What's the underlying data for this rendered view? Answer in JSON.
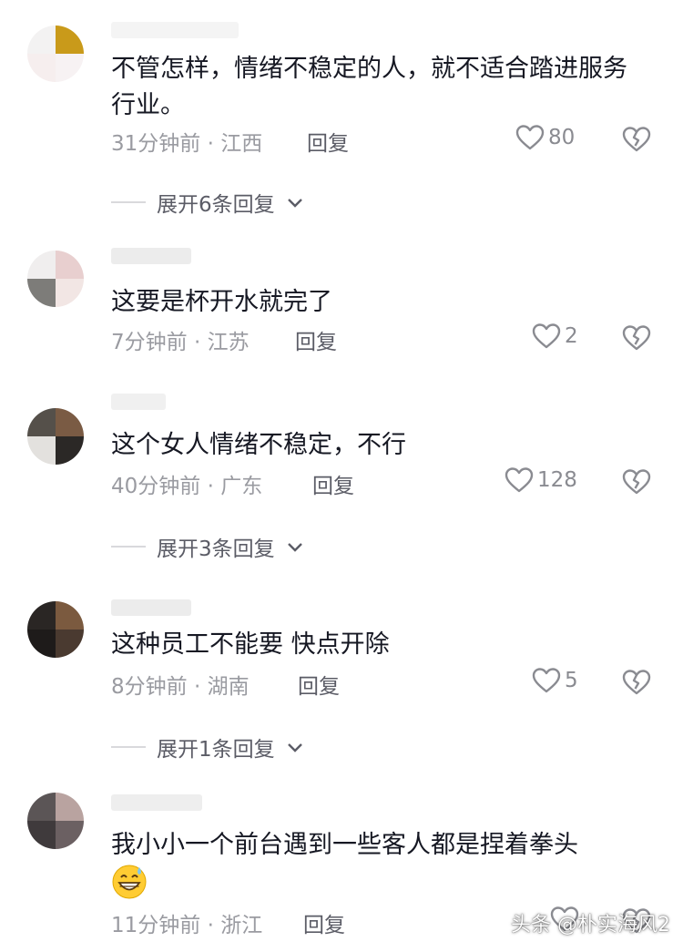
{
  "comments": [
    {
      "text": "不管怎样，情绪不稳定的人，就不适合踏进服务行业。",
      "time": "31分钟前",
      "location": "江西",
      "reply_label": "回复",
      "likes": "80",
      "expand_label": "展开6条回复"
    },
    {
      "text": "这要是杯开水就完了",
      "time": "7分钟前",
      "location": "江苏",
      "reply_label": "回复",
      "likes": "2"
    },
    {
      "text": "这个女人情绪不稳定，不行",
      "time": "40分钟前",
      "location": "广东",
      "reply_label": "回复",
      "likes": "128",
      "expand_label": "展开3条回复"
    },
    {
      "text": "这种员工不能要  快点开除",
      "time": "8分钟前",
      "location": "湖南",
      "reply_label": "回复",
      "likes": "5",
      "expand_label": "展开1条回复"
    },
    {
      "text": "我小小一个前台遇到一些客人都是捏着拳头",
      "emoji": "grinning-sweat-emoji",
      "time": "11分钟前",
      "location": "浙江",
      "reply_label": "回复"
    }
  ],
  "meta_separator": " · ",
  "watermark": "头条 @朴实海风2",
  "colors": {
    "text": "#161823",
    "meta": "#9a9ba1",
    "icon": "#8a8b91"
  }
}
